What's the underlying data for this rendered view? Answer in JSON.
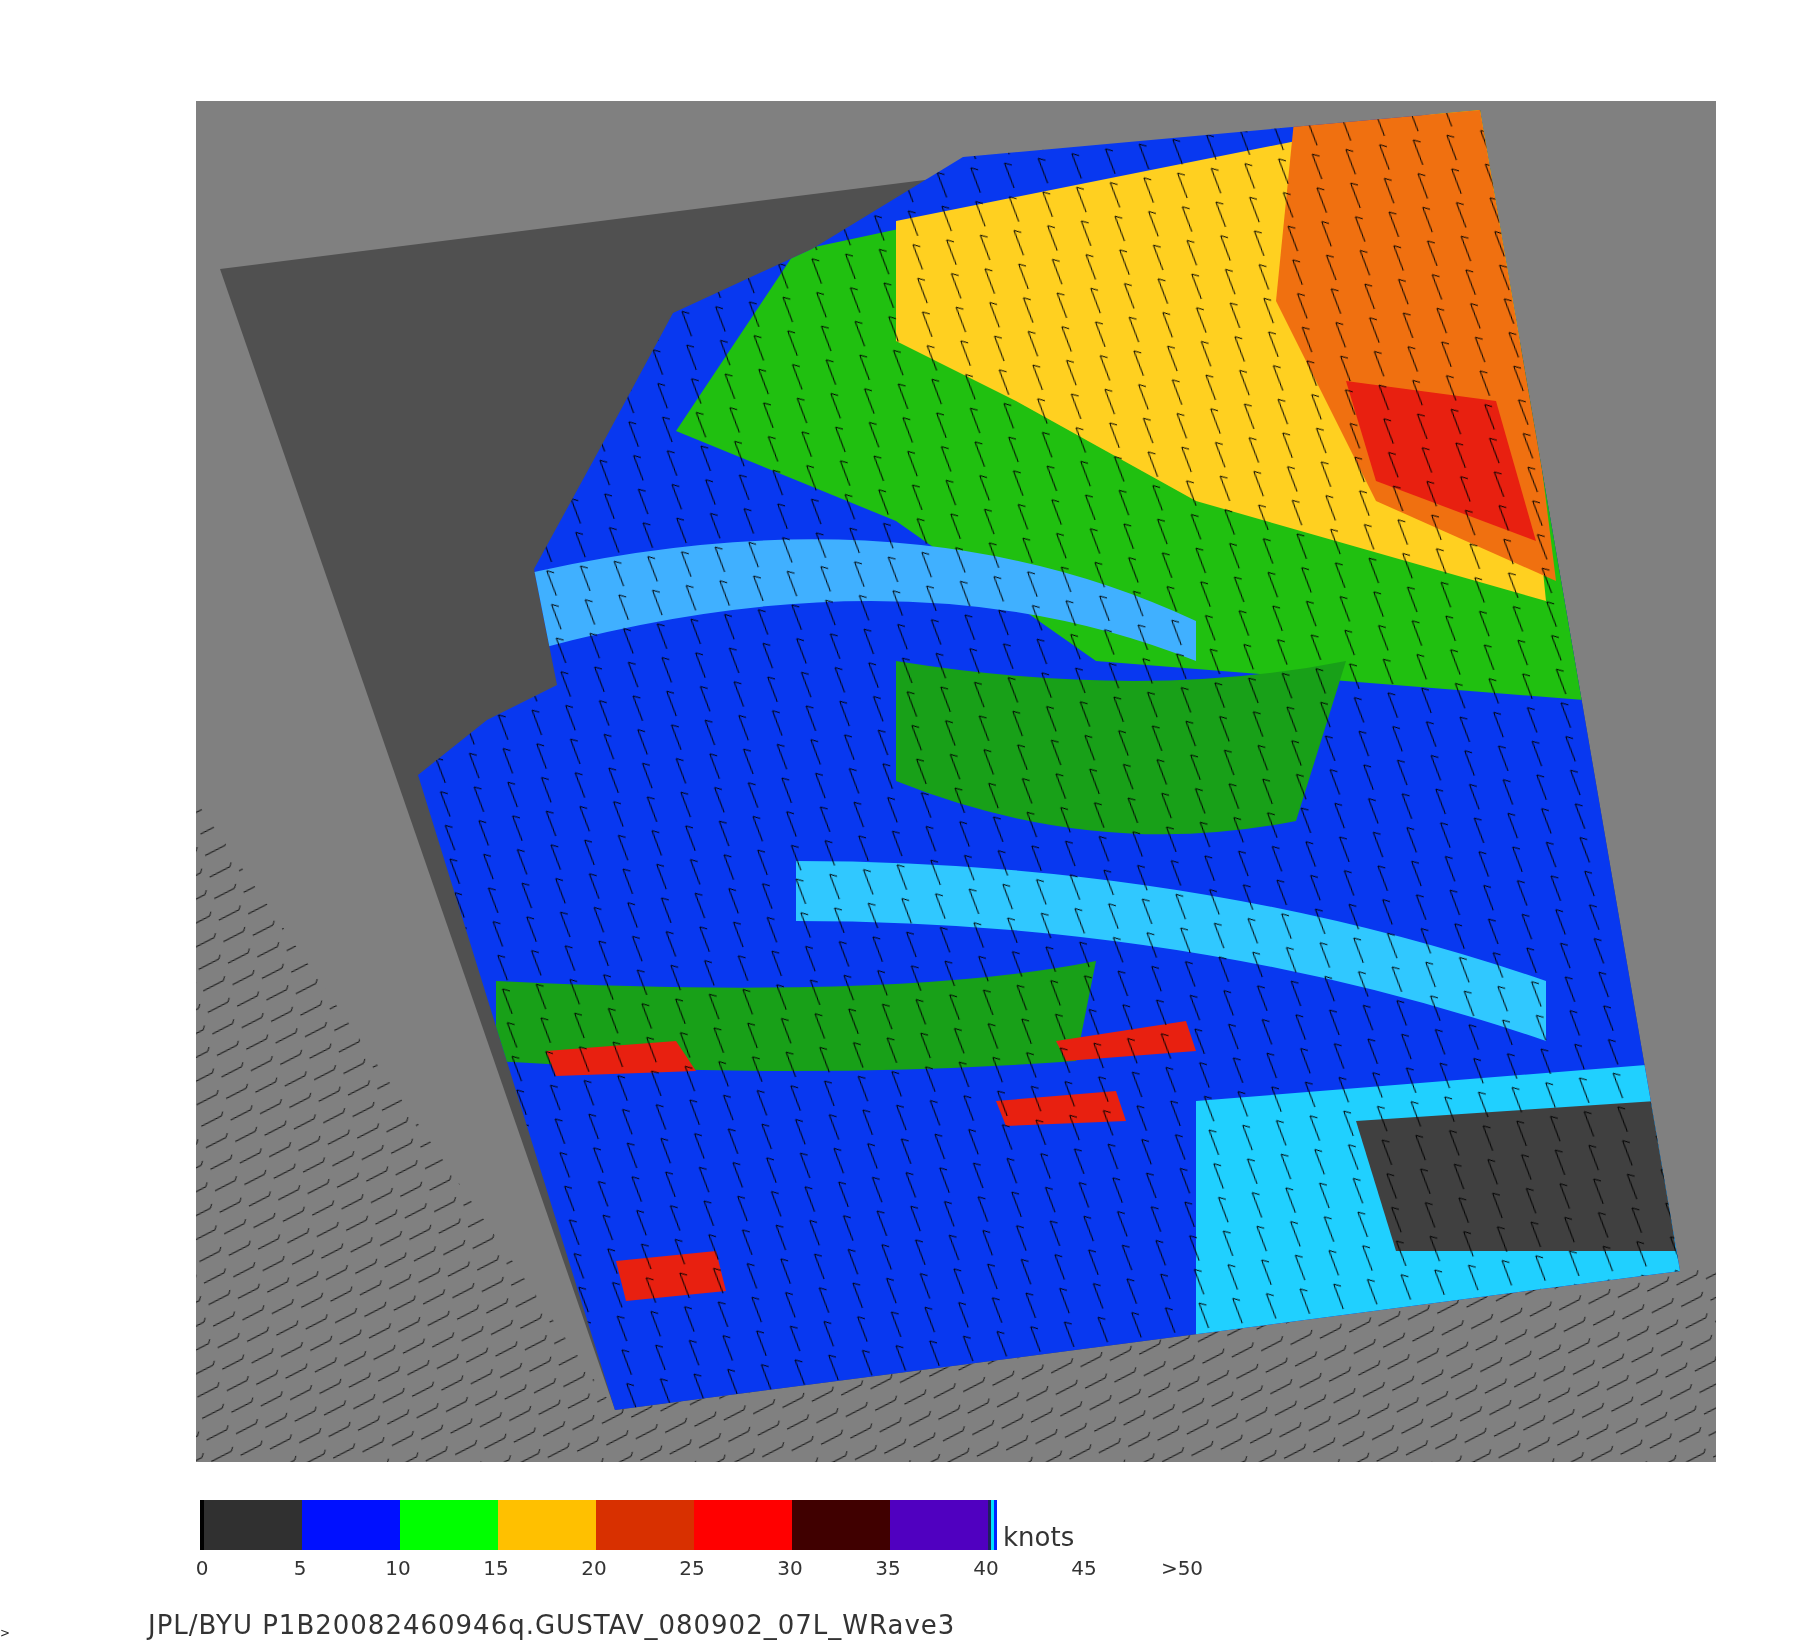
{
  "colorbar": {
    "segments": [
      {
        "color": "#303030"
      },
      {
        "color": "#0010ff"
      },
      {
        "color": "#00ff00"
      },
      {
        "color": "#ffc000"
      },
      {
        "color": "#d83000"
      },
      {
        "color": "#ff0000"
      },
      {
        "color": "#400000"
      },
      {
        "color": "#5000c0"
      }
    ],
    "ticks": [
      "0",
      "5",
      "10",
      "15",
      "20",
      "25",
      "30",
      "35",
      "40",
      "45",
      ">50"
    ],
    "unit": "knots"
  },
  "caption": "JPL/BYU  P1B20082460946q.GUSTAV_080902_07L_WRave3",
  "corner_mark": ">"
}
